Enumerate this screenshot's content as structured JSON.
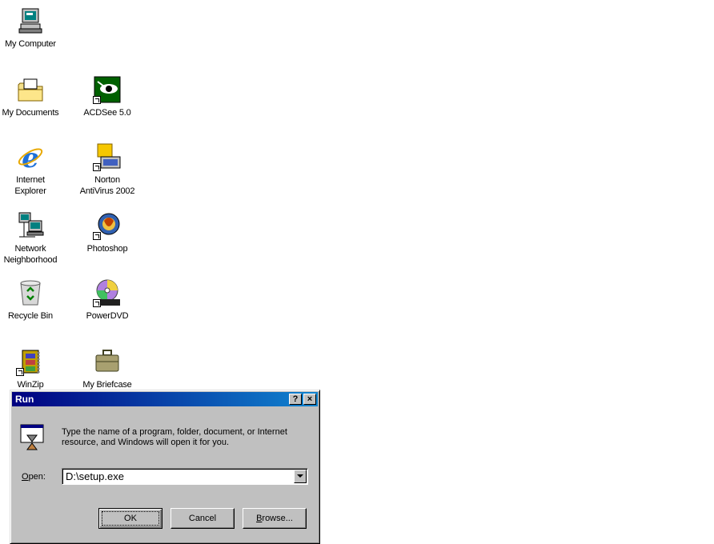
{
  "desktop": {
    "icons": [
      {
        "label": "My Computer",
        "icon": "my-computer-icon"
      },
      {
        "label": "My Documents",
        "icon": "my-documents-icon"
      },
      {
        "label": "ACDSee 5.0",
        "icon": "acdsee-icon"
      },
      {
        "label": "Internet\nExplorer",
        "icon": "internet-explorer-icon"
      },
      {
        "label": "Norton\nAntiVirus 2002",
        "icon": "norton-antivirus-icon"
      },
      {
        "label": "Network\nNeighborhood",
        "icon": "network-neighborhood-icon"
      },
      {
        "label": "Photoshop",
        "icon": "photoshop-icon"
      },
      {
        "label": "Recycle Bin",
        "icon": "recycle-bin-icon"
      },
      {
        "label": "PowerDVD",
        "icon": "powerdvd-icon"
      },
      {
        "label": "WinZip",
        "icon": "winzip-icon"
      },
      {
        "label": "My Briefcase",
        "icon": "briefcase-icon"
      }
    ]
  },
  "run_dialog": {
    "title": "Run",
    "help_button": "?",
    "close_button": "×",
    "prompt": "Type the name of a program, folder, document, or Internet resource, and Windows will open it for you.",
    "open_label_accel": "O",
    "open_label_rest": "pen:",
    "open_value": "D:\\setup.exe",
    "ok_label": "OK",
    "cancel_label": "Cancel",
    "browse_label_accel": "B",
    "browse_label_rest": "rowse..."
  },
  "colors": {
    "titlebar_start": "#000080",
    "titlebar_end": "#1084d0",
    "face": "#c0c0c0"
  }
}
